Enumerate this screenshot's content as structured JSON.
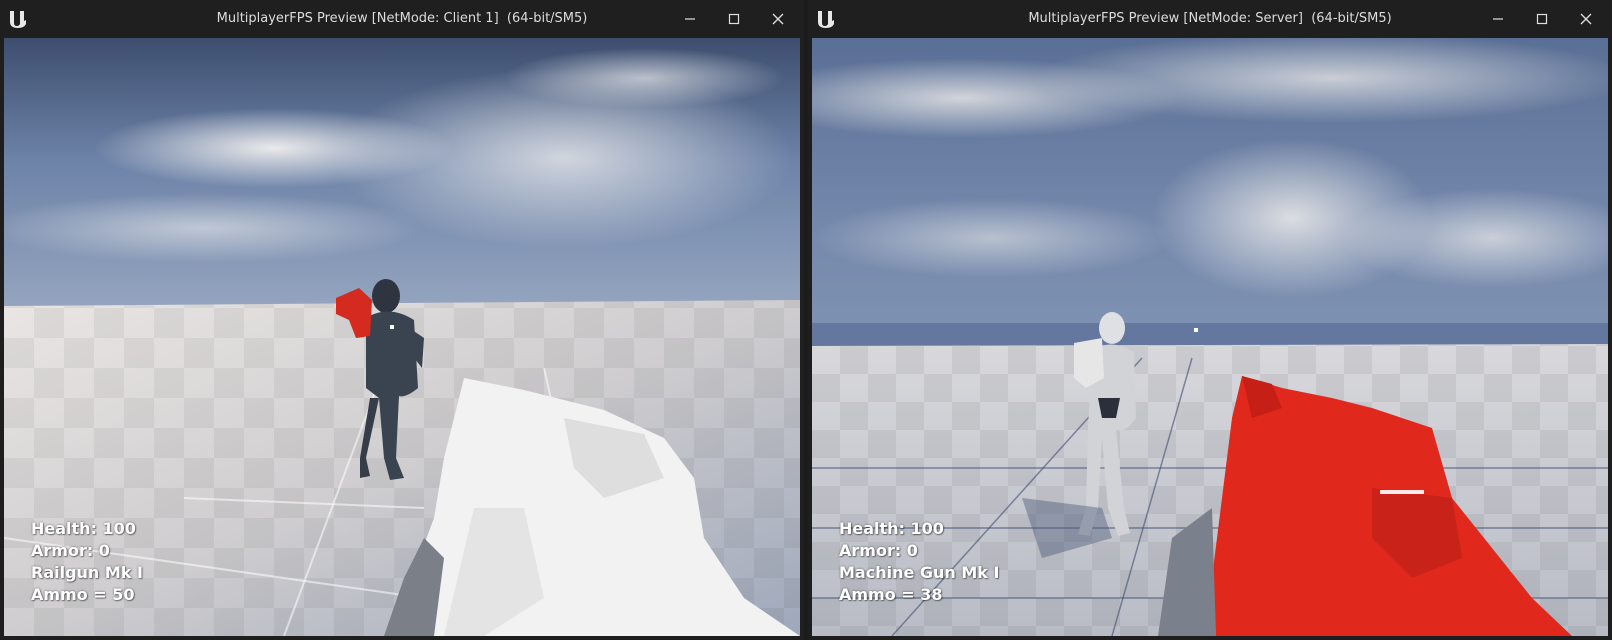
{
  "windows": {
    "client": {
      "title": "MultiplayerFPS Preview [NetMode: Client 1]  (64-bit/SM5)",
      "hud": {
        "health": "Health: 100",
        "armor": "Armor: 0",
        "weapon": "Railgun Mk I",
        "ammo": "Ammo = 50"
      }
    },
    "server": {
      "title": "MultiplayerFPS Preview [NetMode: Server]  (64-bit/SM5)",
      "hud": {
        "health": "Health: 100",
        "armor": "Armor: 0",
        "weapon": "Machine Gun Mk I",
        "ammo": "Ammo = 38"
      }
    }
  },
  "icons": {
    "logo": "unreal-logo-icon",
    "minimize": "minimize-icon",
    "maximize": "maximize-icon",
    "close": "close-icon"
  },
  "colors": {
    "titlebar": "#1f1f1f",
    "sky": "#6f86ad",
    "floor": "#c9c9cc",
    "red_weapon": "#e0281d",
    "hud_text": "#ffffff"
  }
}
